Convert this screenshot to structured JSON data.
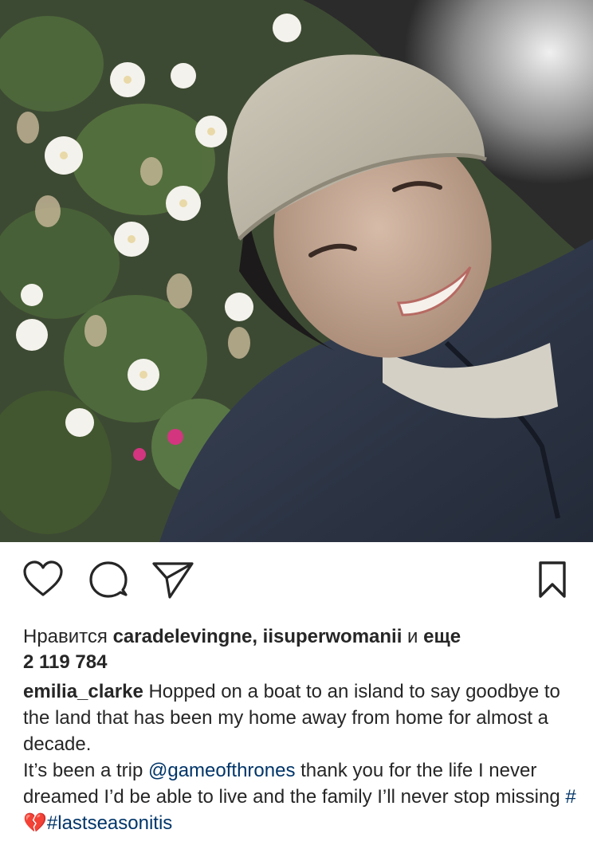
{
  "post": {
    "image_description_alt": "",
    "icons": {
      "like": "heart-outline-icon",
      "comment": "comment-bubble-icon",
      "share": "paper-plane-icon",
      "save": "bookmark-icon"
    },
    "likes": {
      "prefix": "Нравится",
      "user1": "caradelevingne",
      "separator": ",",
      "user2": "iisuperwomanii",
      "and": "и",
      "more": "еще",
      "count": "2 119 784"
    },
    "caption": {
      "username": "emilia_clarke",
      "line1": "Hopped on a boat to an island to say goodbye to the land that has been my home away from home for almost a decade.",
      "line2_before": "It’s been a trip",
      "mention": "@gameofthrones",
      "line2_after": "thank you for the life I never dreamed I’d be able to live and the family I’ll never stop missing",
      "hashtag1": "#💔",
      "hashtag2": "#lastseasonitis"
    }
  },
  "colors": {
    "text": "#262626",
    "link": "#003569",
    "icon": "#262626"
  }
}
